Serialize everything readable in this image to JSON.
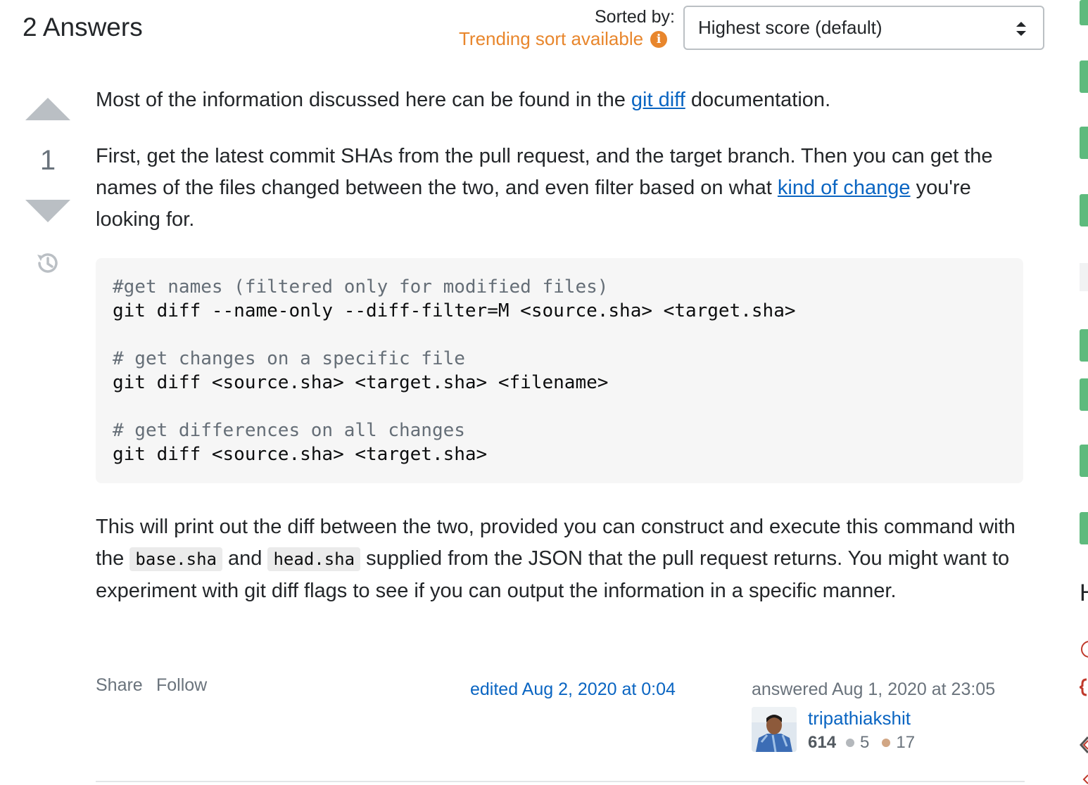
{
  "header": {
    "answers_title": "2 Answers",
    "sorted_by_label": "Sorted by:",
    "trending_text": "Trending sort available",
    "sort_selected": "Highest score (default)"
  },
  "answer": {
    "vote_count": "1",
    "p1_before": "Most of the information discussed here can be found in the ",
    "p1_link": "git diff",
    "p1_after": " documentation.",
    "p2_before": "First, get the latest commit SHAs from the pull request, and the target branch. Then you can get the names of the files changed between the two, and even filter based on what ",
    "p2_link": "kind of change",
    "p2_after": " you're looking for.",
    "code": {
      "l1": "#get names (filtered only for modified files)",
      "l2": "git diff --name-only --diff-filter=M <source.sha> <target.sha>",
      "l3": "# get changes on a specific file",
      "l4": "git diff <source.sha> <target.sha> <filename>",
      "l5": "# get differences on all changes",
      "l6": "git diff <source.sha> <target.sha>"
    },
    "p3_a": "This will print out the diff between the two, provided you can construct and execute this command with the ",
    "p3_code1": "base.sha",
    "p3_b": " and ",
    "p3_code2": "head.sha",
    "p3_c": " supplied from the JSON that the pull request returns. You might want to experiment with git diff flags to see if you can output the information in a specific manner."
  },
  "footer": {
    "share": "Share",
    "follow": "Follow",
    "edited": "edited Aug 2, 2020 at 0:04",
    "answered": "answered Aug 1, 2020 at 23:05",
    "user": {
      "name": "tripathiakshit",
      "reputation": "614",
      "silver_badges": "5",
      "bronze_badges": "17"
    }
  },
  "sidebar": {
    "heading_fragment": "H"
  },
  "colors": {
    "link": "#0a65c2",
    "trending": "#e8862c",
    "vote_arrow": "#babfc4",
    "side_accent": "#5eba7d",
    "silver_badge": "#b4b8bc",
    "bronze_badge": "#d1a684"
  }
}
